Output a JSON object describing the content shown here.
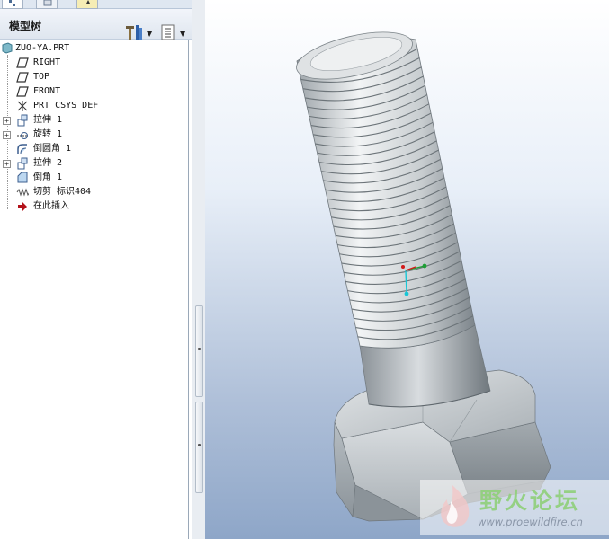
{
  "panel": {
    "title": "模型树",
    "tabs": [
      {
        "name": "model-tree"
      },
      {
        "name": "folder-browser"
      },
      {
        "name": "favorites"
      }
    ],
    "tools": {
      "settings": "settings-tools-icon",
      "show": "show-list-icon"
    }
  },
  "tree": {
    "root": {
      "label": "ZUO-YA.PRT",
      "icon": "part-icon"
    },
    "items": [
      {
        "label": "RIGHT",
        "icon": "datum-plane-icon",
        "expandable": false
      },
      {
        "label": "TOP",
        "icon": "datum-plane-icon",
        "expandable": false
      },
      {
        "label": "FRONT",
        "icon": "datum-plane-icon",
        "expandable": false
      },
      {
        "label": "PRT_CSYS_DEF",
        "icon": "coordinate-system-icon",
        "expandable": false
      },
      {
        "label": "拉伸 1",
        "icon": "extrude-icon",
        "expandable": true
      },
      {
        "label": "旋转 1",
        "icon": "revolve-icon",
        "expandable": true
      },
      {
        "label": "倒圆角 1",
        "icon": "round-icon",
        "expandable": false
      },
      {
        "label": "拉伸 2",
        "icon": "extrude-icon",
        "expandable": true
      },
      {
        "label": "倒角 1",
        "icon": "chamfer-icon",
        "expandable": false
      },
      {
        "label": "切剪 标识404",
        "icon": "cosmetic-thread-icon",
        "expandable": false
      },
      {
        "label": "在此插入",
        "icon": "insert-here-arrow-icon",
        "expandable": false
      }
    ]
  },
  "viewport": {
    "model": "hex-bolt",
    "background_top": "#ffffff",
    "background_bottom": "#8ea6c8"
  },
  "watermark": {
    "title": "野火论坛",
    "url": "www.proewildfire.cn"
  }
}
